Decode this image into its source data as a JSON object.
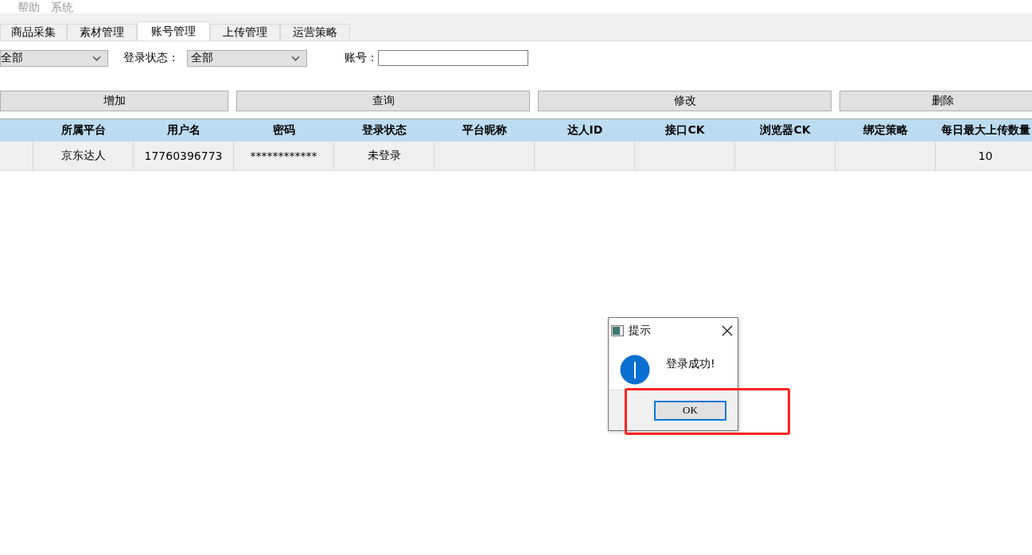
{
  "menu": [
    "帮助",
    "系统"
  ],
  "tabs": [
    {
      "label": "商品采集",
      "selected": false
    },
    {
      "label": "素材管理",
      "selected": false
    },
    {
      "label": "账号管理",
      "selected": true
    },
    {
      "label": "上传管理",
      "selected": false
    },
    {
      "label": "运营策略",
      "selected": false
    }
  ],
  "filters": {
    "platform_select": "全部",
    "status_label": "登录状态：",
    "status_select": "全部",
    "account_label": "账号："
  },
  "buttons": [
    "增加",
    "查询",
    "修改",
    "删除"
  ],
  "table": {
    "columns": [
      null,
      "所属平台",
      "用户名",
      "密码",
      "登录状态",
      "平台昵称",
      "达人ID",
      "接口CK",
      "浏览器CK",
      "绑定策略",
      "每日最大上传数量"
    ],
    "rows": [
      {
        "cells": [
          null,
          "京东达人",
          "17760396773",
          "************",
          "未登录",
          null,
          null,
          null,
          null,
          null,
          "10"
        ]
      }
    ]
  },
  "dialog": {
    "title": "提示",
    "message": "登录成功!",
    "button": "OK"
  }
}
